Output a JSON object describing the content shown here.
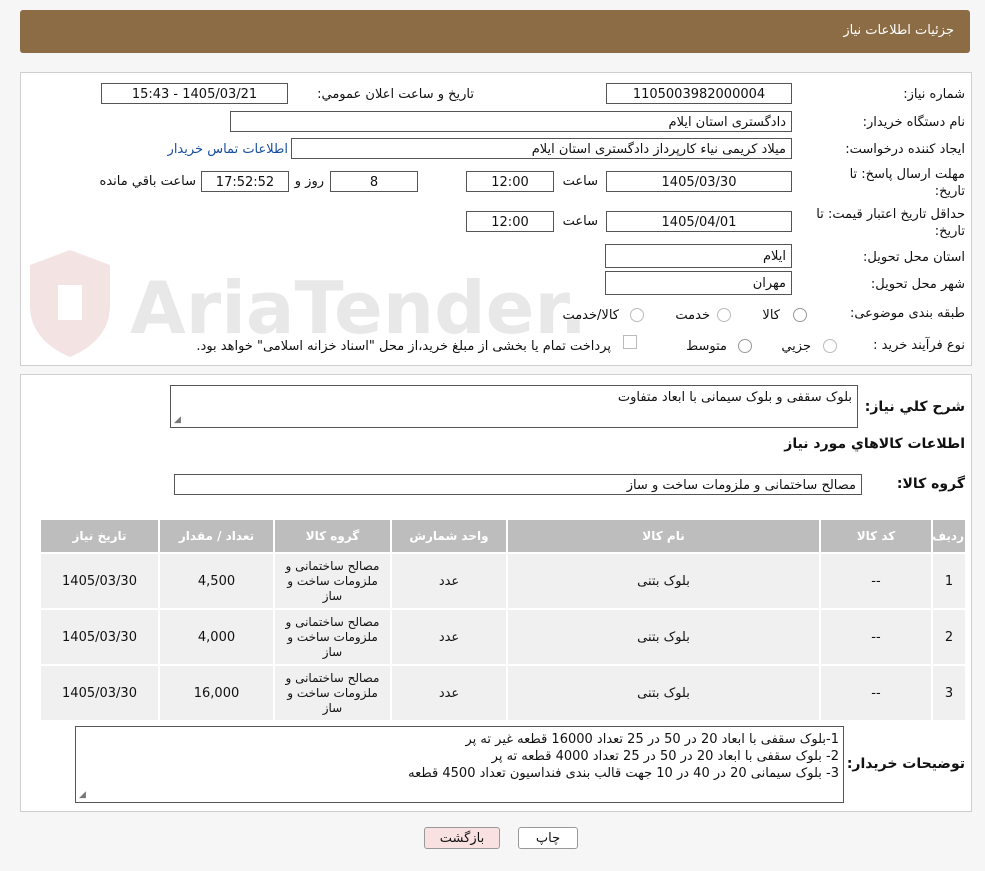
{
  "header": {
    "title": "جزئیات اطلاعات نیاز"
  },
  "form": {
    "need_number_label": "شماره نیاز:",
    "need_number": "1105003982000004",
    "announce_label": "تاریخ و ساعت اعلان عمومي:",
    "announce_value": "1405/03/21 - 15:43",
    "buyer_org_label": "نام دستگاه خريدار:",
    "buyer_org": "دادگستری استان ایلام",
    "requester_label": "ايجاد کننده درخواست:",
    "requester": "میلاد کریمی نیاء کارپرداز دادگستری استان ایلام",
    "contact_link": "اطلاعات تماس خريدار",
    "deadline_label_1": "مهلت ارسال پاسخ: تا",
    "deadline_label_2": "تاريخ:",
    "deadline_date": "1405/03/30",
    "time_label": "ساعت",
    "deadline_time": "12:00",
    "days_value": "8",
    "days_label": "روز و",
    "remaining_time": "17:52:52",
    "remaining_label": "ساعت باقي مانده",
    "validity_label_1": "حداقل تاريخ اعتبار قيمت: تا",
    "validity_label_2": "تاريخ:",
    "validity_date": "1405/04/01",
    "validity_time": "12:00",
    "province_label": "استان محل تحويل:",
    "province": "ایلام",
    "city_label": "شهر محل تحويل:",
    "city": "مهران",
    "category_label": "طبقه بندی موضوعی:",
    "category_options": [
      "کالا",
      "خدمت",
      "کالا/خدمت"
    ],
    "process_label": "نوع فرآيند خريد :",
    "process_options": [
      "جزيي",
      "متوسط"
    ],
    "payment_note": "پرداخت تمام يا بخشی از مبلغ خريد،از محل \"اسناد خزانه اسلامی\" خواهد بود."
  },
  "details": {
    "summary_label": "شرح کلي نياز:",
    "summary": "بلوک سقفی و بلوک سیمانی با ابعاد متفاوت",
    "items_heading": "اطلاعات کالاهاي مورد نياز",
    "group_label": "گروه کالا:",
    "group": "مصالح ساختمانی و ملزومات ساخت و ساز"
  },
  "table": {
    "headers": [
      "رديف",
      "کد کالا",
      "نام کالا",
      "واحد شمارش",
      "گروه کالا",
      "تعداد / مقدار",
      "تاريخ نياز"
    ],
    "rows": [
      {
        "row": "1",
        "code": "--",
        "name": "بلوک بتنی",
        "unit": "عدد",
        "group": "مصالح ساختمانی و ملزومات ساخت و ساز",
        "qty": "4,500",
        "date": "1405/03/30"
      },
      {
        "row": "2",
        "code": "--",
        "name": "بلوک بتنی",
        "unit": "عدد",
        "group": "مصالح ساختمانی و ملزومات ساخت و ساز",
        "qty": "4,000",
        "date": "1405/03/30"
      },
      {
        "row": "3",
        "code": "--",
        "name": "بلوک بتنی",
        "unit": "عدد",
        "group": "مصالح ساختمانی و ملزومات ساخت و ساز",
        "qty": "16,000",
        "date": "1405/03/30"
      }
    ]
  },
  "buyer_notes": {
    "label": "توضیحات خریدار:",
    "lines": [
      "1-بلوک سقفی با ابعاد 20 در 50 در 25   تعداد  16000 قطعه غیر ته پر",
      "2- بلوک سقفی با ابعاد 20 در 50 در  25 تعداد  4000 قطعه  ته پر",
      "3- بلوک سیمانی  20 در  40 در  10 جهت قالب بندی فنداسیون تعداد  4500 قطعه"
    ]
  },
  "buttons": {
    "print": "چاپ",
    "back": "بازگشت"
  },
  "watermark": {
    "text": "AriaTender.neT"
  },
  "colors": {
    "header": "#8b6c44",
    "link": "#1a4fa0",
    "back_button": "#f9e1e1"
  }
}
